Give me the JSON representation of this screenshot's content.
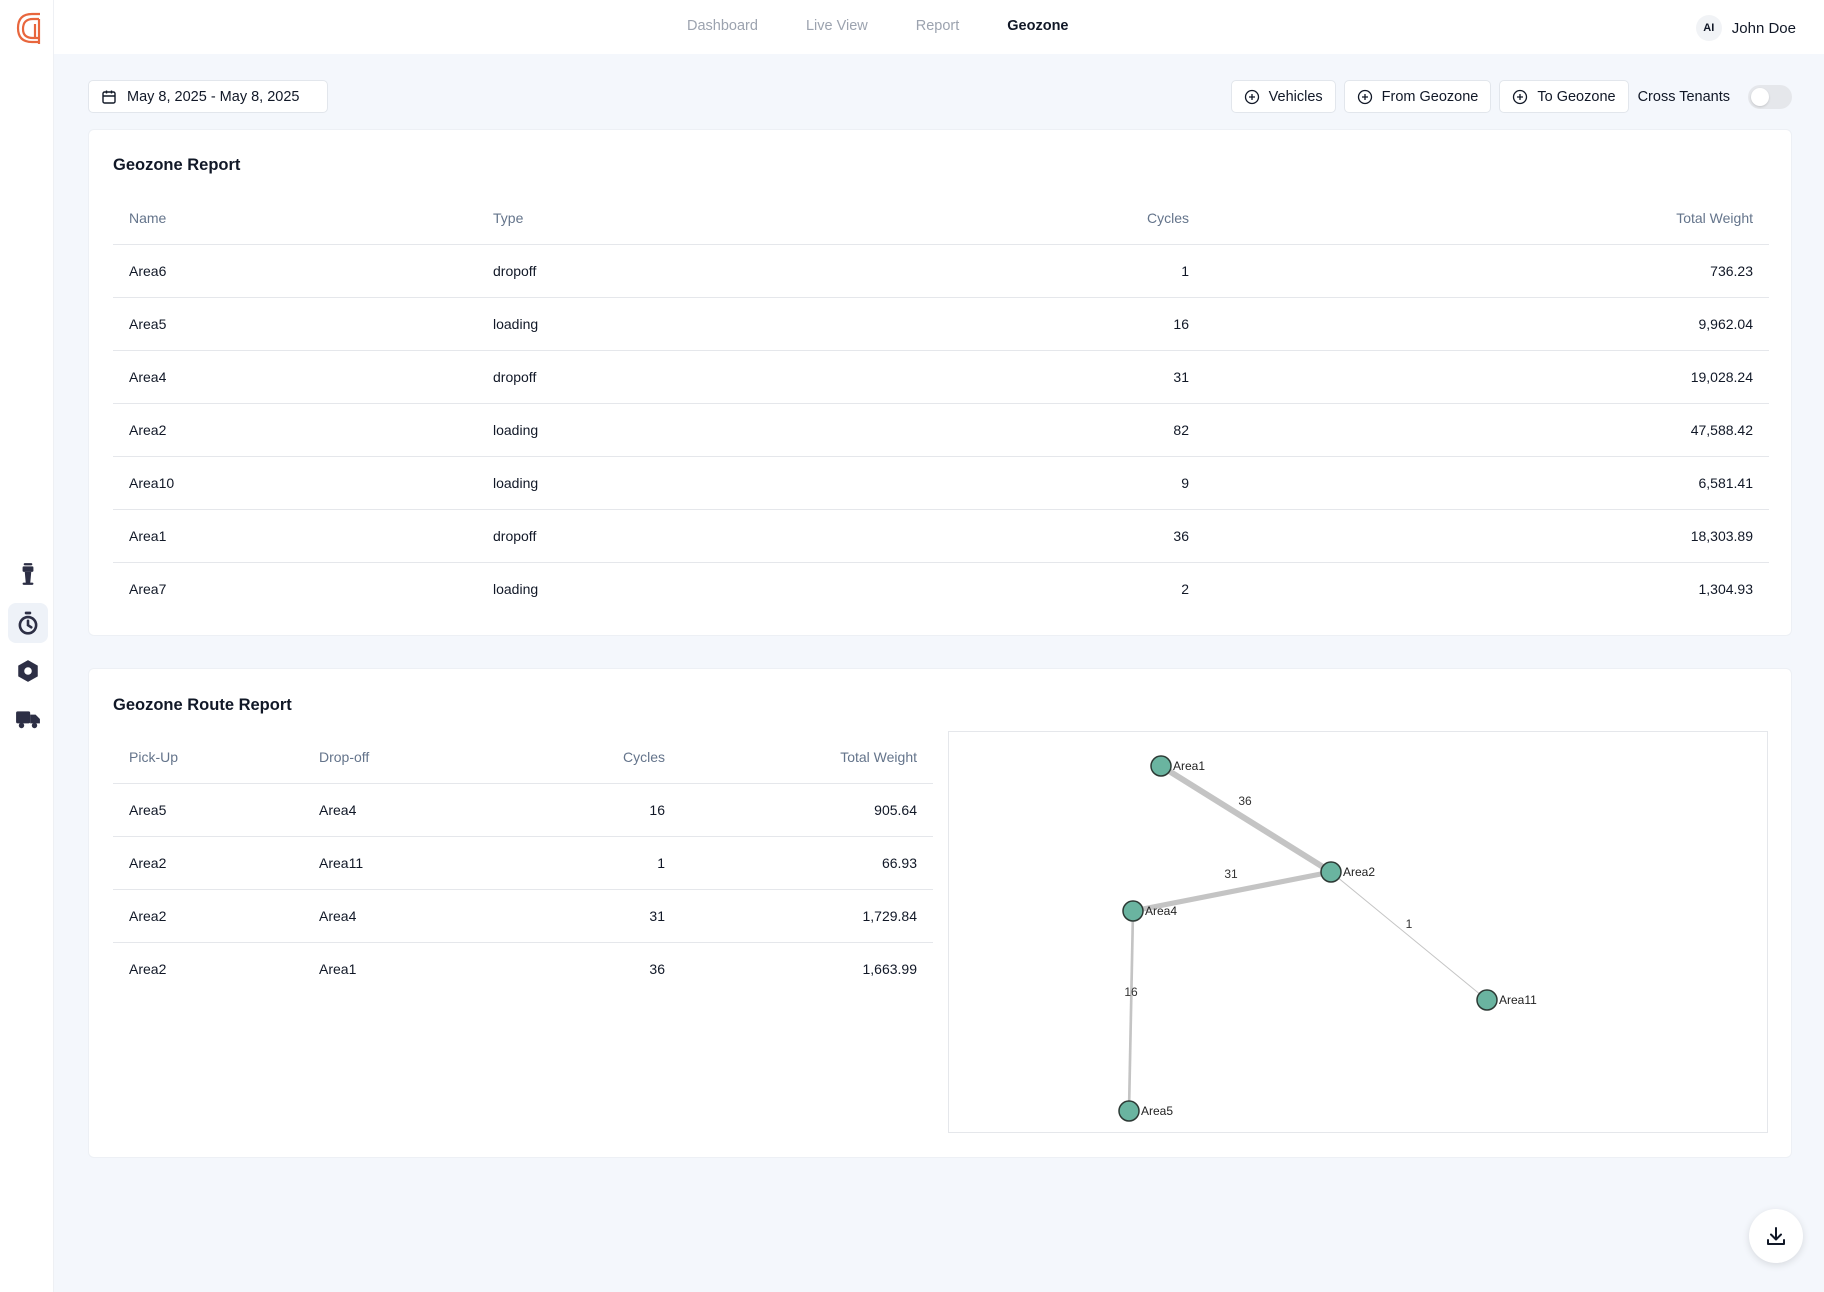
{
  "nav": {
    "items": [
      {
        "label": "Dashboard",
        "active": false
      },
      {
        "label": "Live View",
        "active": false
      },
      {
        "label": "Report",
        "active": false
      },
      {
        "label": "Geozone",
        "active": true
      }
    ]
  },
  "user": {
    "initials": "AI",
    "name": "John Doe"
  },
  "sidebar": {
    "icons": [
      "tower-icon",
      "timer-icon",
      "hexagon-icon",
      "truck-icon"
    ],
    "active_index": 1
  },
  "filters": {
    "date_range": "May 8, 2025 - May 8, 2025",
    "vehicles": "Vehicles",
    "from_geozone": "From Geozone",
    "to_geozone": "To Geozone",
    "cross_tenants": "Cross Tenants",
    "cross_tenants_on": false
  },
  "geozone_report": {
    "title": "Geozone Report",
    "columns": [
      "Name",
      "Type",
      "Cycles",
      "Total Weight"
    ],
    "rows": [
      [
        "Area6",
        "dropoff",
        "1",
        "736.23"
      ],
      [
        "Area5",
        "loading",
        "16",
        "9,962.04"
      ],
      [
        "Area4",
        "dropoff",
        "31",
        "19,028.24"
      ],
      [
        "Area2",
        "loading",
        "82",
        "47,588.42"
      ],
      [
        "Area10",
        "loading",
        "9",
        "6,581.41"
      ],
      [
        "Area1",
        "dropoff",
        "36",
        "18,303.89"
      ],
      [
        "Area7",
        "loading",
        "2",
        "1,304.93"
      ]
    ]
  },
  "route_report": {
    "title": "Geozone Route Report",
    "columns": [
      "Pick-Up",
      "Drop-off",
      "Cycles",
      "Total Weight"
    ],
    "rows": [
      [
        "Area5",
        "Area4",
        "16",
        "905.64"
      ],
      [
        "Area2",
        "Area11",
        "1",
        "66.93"
      ],
      [
        "Area2",
        "Area4",
        "31",
        "1,729.84"
      ],
      [
        "Area2",
        "Area1",
        "36",
        "1,663.99"
      ]
    ]
  },
  "route_graph": {
    "node_color": "#6ab4a0",
    "nodes": [
      "Area1",
      "Area2",
      "Area4",
      "Area11",
      "Area5"
    ],
    "edges": [
      {
        "from": "Area1",
        "to": "Area2",
        "label": "36"
      },
      {
        "from": "Area2",
        "to": "Area4",
        "label": "31"
      },
      {
        "from": "Area2",
        "to": "Area11",
        "label": "1"
      },
      {
        "from": "Area4",
        "to": "Area5",
        "label": "16"
      }
    ]
  },
  "brand_color": "#e8663d"
}
